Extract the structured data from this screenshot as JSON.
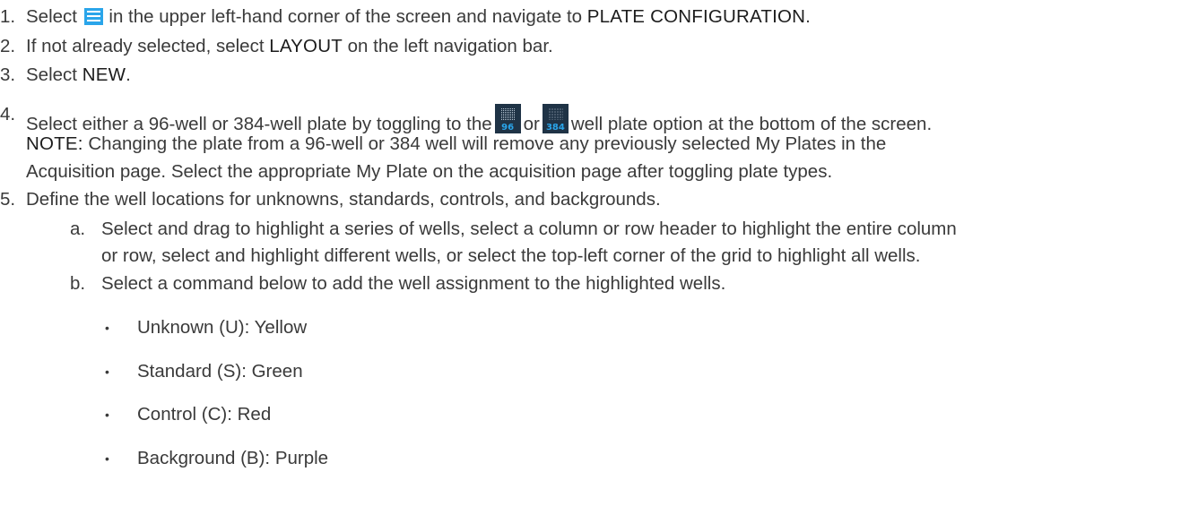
{
  "steps": {
    "s1": {
      "num": "1.",
      "before": "Select",
      "after": "in the upper left-hand corner of the screen and navigate to",
      "kw": "PLATE CONFIGURATION",
      "end": "."
    },
    "s2": {
      "num": "2.",
      "before": "If not already selected, select",
      "kw": "LAYOUT",
      "after": "on the left navigation bar."
    },
    "s3": {
      "num": "3.",
      "before": "Select",
      "kw": "NEW",
      "end": "."
    },
    "s4": {
      "num": "4.",
      "before": "Select either a 96-well or 384-well plate by toggling to the",
      "or": "or",
      "after": "well plate option at the bottom of the screen.",
      "note_kw": "NOTE:",
      "note_text": "Changing the plate from a 96-well or 384 well will remove any previously selected My Plates in the",
      "note_cont": "Acquisition page. Select the appropriate My Plate on the acquisition page after toggling plate types."
    },
    "s5": {
      "num": "5.",
      "text": "Define the well locations for unknowns, standards, controls, and  backgrounds."
    },
    "sa": {
      "letter": "a.",
      "line1": "Select and drag to highlight a series of wells, select a column or row header to highlight the entire column",
      "line2": "or row, select and highlight different wells, or select the top-left corner of the grid to highlight all  wells."
    },
    "sb": {
      "letter": "b.",
      "text": "Select a command below to add the well assignment to the highlighted wells."
    }
  },
  "icons": {
    "menu": "menu-icon",
    "plate96": {
      "name": "plate-96-icon",
      "label": "96"
    },
    "plate384": {
      "name": "plate-384-icon",
      "label": "384"
    }
  },
  "bullets": [
    {
      "symbol": "•",
      "text": "Unknown (U): Yellow"
    },
    {
      "symbol": "•",
      "text": "Standard (S): Green"
    },
    {
      "symbol": "•",
      "text": "Control (C): Red"
    },
    {
      "symbol": "•",
      "text": "Background (B): Purple"
    }
  ],
  "colors": {
    "text": "#3a3a3a",
    "keyword": "#1c1c1c",
    "menu_icon": "#2aa5ea",
    "plate_icon_bg": "#1f3346",
    "plate_icon_label": "#2aa5ea"
  }
}
